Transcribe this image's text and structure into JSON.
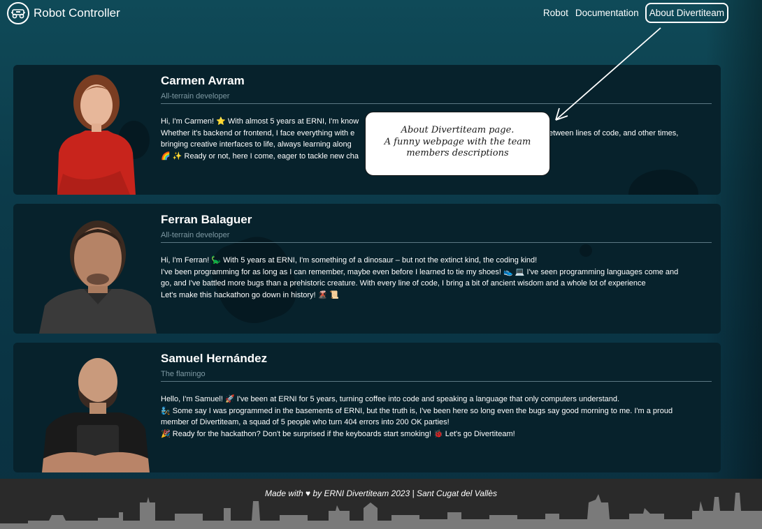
{
  "header": {
    "title": "Robot Controller",
    "logo_icon": "robot-car-icon",
    "nav": [
      {
        "label": "Robot",
        "active": false
      },
      {
        "label": "Documentation",
        "active": false
      },
      {
        "label": "About Divertiteam",
        "active": true
      }
    ]
  },
  "members": [
    {
      "name": "Carmen Avram",
      "role": "All-terrain developer",
      "bio": [
        "Hi, I'm Carmen! ⭐ With almost 5 years at ERNI, I'm know",
        "Whether it's backend or frontend, I face everything with e",
        "bringing creative interfaces to life, always learning along",
        "🌈 ✨ Ready or not, here I come, eager to tackle new cha"
      ],
      "bio_hidden_right": "etween lines of code, and other times,"
    },
    {
      "name": "Ferran Balaguer",
      "role": "All-terrain developer",
      "bio": [
        "Hi, I'm Ferran! 🦕 With 5 years at ERNI, I'm something of a dinosaur – but not the extinct kind, the coding kind!",
        "I've been programming for as long as I can remember, maybe even before I learned to tie my shoes! 👟 💻 I've seen programming languages come and",
        "go, and I've battled more bugs than a prehistoric creature. With every line of code, I bring a bit of ancient wisdom and a whole lot of experience",
        "Let's make this hackathon go down in history! 🌋 📜"
      ]
    },
    {
      "name": "Samuel Hernández",
      "role": "The flamingo",
      "bio": [
        "Hello, I'm Samuel! 🚀 I've been at ERNI for 5 years, turning coffee into code and speaking a language that only computers understand.",
        "🧞 Some say I was programmed in the basements of ERNI, but the truth is, I've been here so long even the bugs say good morning to me. I'm a proud",
        "member of Divertiteam, a squad of 5 people who turn 404 errors into 200 OK parties!",
        "🎉 Ready for the hackathon? Don't be surprised if the keyboards start smoking! 🐞 Let's go Divertiteam!"
      ]
    }
  ],
  "callout": {
    "lines": [
      "About Divertiteam page.",
      "A funny webpage with the team",
      "members descriptions"
    ]
  },
  "footer": {
    "text": "Made with ♥ by ERNI Divertiteam 2023 | Sant Cugat del Vallès"
  },
  "colors": {
    "card_bg": "#07222c",
    "role_text": "#7e99a3",
    "footer_bg": "#2a2a2a",
    "skyline": "#7a7a7a"
  }
}
